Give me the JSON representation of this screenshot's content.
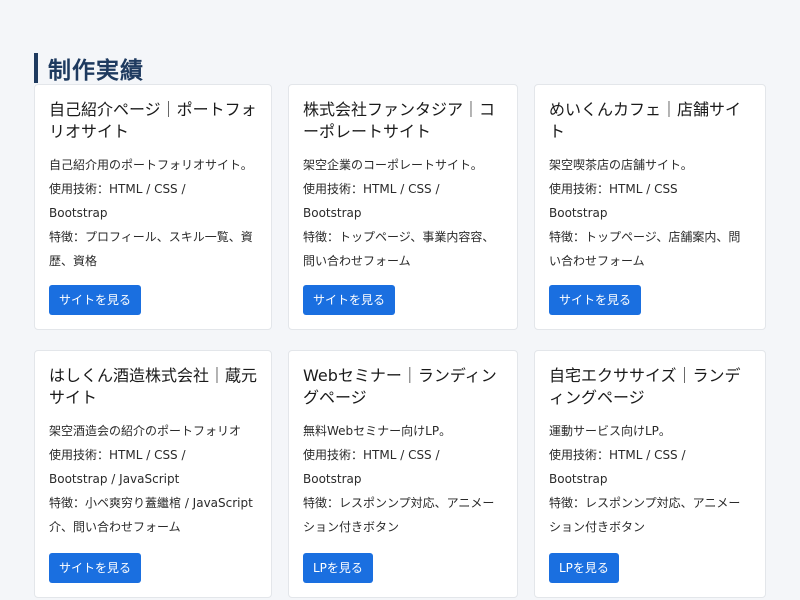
{
  "section": {
    "title": "制作実績"
  },
  "cards": [
    {
      "title": "自己紹介ページ｜ポートフォリオサイト",
      "lines": [
        "自己紹介用のポートフォリオサイト。",
        "使用技術：HTML / CSS /",
        "Bootstrap",
        "特徴：プロフィール、スキル一覧、資歴、資格"
      ],
      "button": "サイトを見る"
    },
    {
      "title": "株式会社ファンタジア｜コーポレートサイト",
      "lines": [
        "架空企業のコーポレートサイト。",
        "使用技術：HTML / CSS /",
        "Bootstrap",
        "特徴：トップページ、事業内容容、問い合わせフォーム"
      ],
      "button": "サイトを見る"
    },
    {
      "title": "めいくんカフェ｜店舗サイト",
      "lines": [
        "架空喫茶店の店舗サイト。",
        "使用技術：HTML / CSS",
        "Bootstrap",
        "特徴：トップページ、店舗案内、問い合わせフォーム"
      ],
      "button": "サイトを見る"
    },
    {
      "title": "はしくん酒造株式会社｜蔵元サイト",
      "lines": [
        "架空酒造会の紹介のポートフォリオ",
        "使用技術：HTML / CSS /",
        "Bootstrap / JavaScript",
        "特徴：小ペ爽穷り蓋繼棺 / JavaScript介、問い合わせフォーム"
      ],
      "button": "サイトを見る"
    },
    {
      "title": "Webセミナー｜ランディングページ",
      "lines": [
        "無料Webセミナー向けLP。",
        "使用技術：HTML / CSS /",
        "Bootstrap",
        "特徴：レスポンンプ対応、アニメーション付きボタン"
      ],
      "button": "LPを見る"
    },
    {
      "title": "自宅エクササイズ｜ランディングページ",
      "lines": [
        "運動サービス向けLP。",
        "使用技術：HTML / CSS /",
        "Bootstrap",
        "特徴：レスポンンプ対応、アニメーション付きボタン"
      ],
      "button": "LPを見る"
    }
  ]
}
